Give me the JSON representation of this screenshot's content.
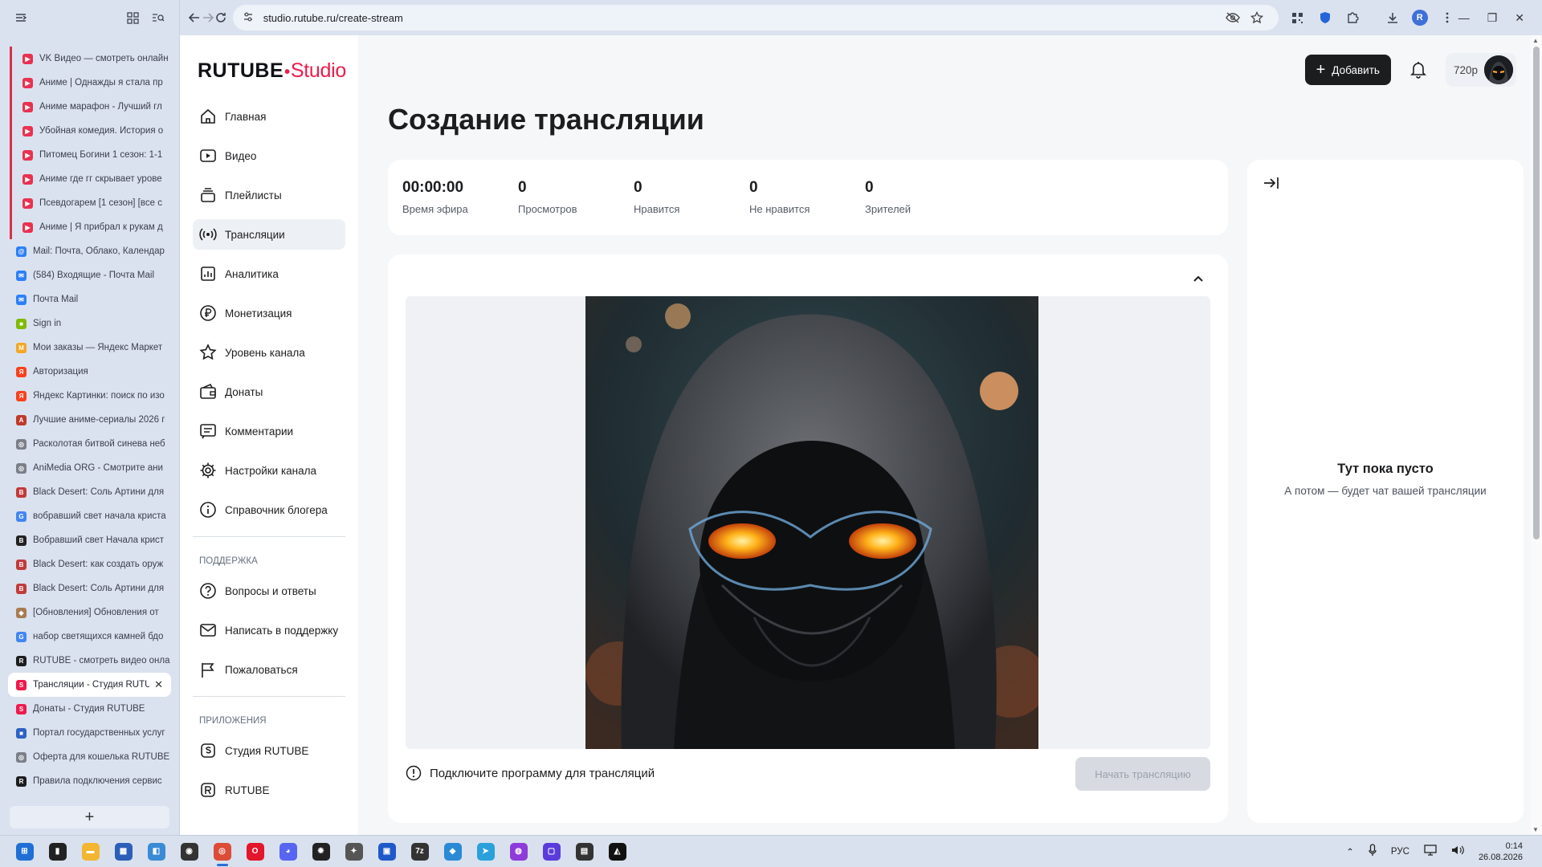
{
  "browser": {
    "url": "studio.rutube.ru/create-stream",
    "tabs": [
      {
        "title": "VK Видео — смотреть онлайн",
        "grouped": true,
        "color": "#e8324f",
        "glyph": "▶"
      },
      {
        "title": "Аниме | Однажды я стала пр",
        "grouped": true,
        "color": "#e8324f",
        "glyph": "▶"
      },
      {
        "title": "Аниме марафон - Лучший гл",
        "grouped": true,
        "color": "#e8324f",
        "glyph": "▶"
      },
      {
        "title": "Убойная комедия. История о",
        "grouped": true,
        "color": "#e8324f",
        "glyph": "▶"
      },
      {
        "title": "Питомец Богини 1 сезон: 1-1",
        "grouped": true,
        "color": "#e8324f",
        "glyph": "▶"
      },
      {
        "title": "Аниме где гг скрывает урове",
        "grouped": true,
        "color": "#e8324f",
        "glyph": "▶"
      },
      {
        "title": "Псевдогарем [1 сезон] [все с",
        "grouped": true,
        "color": "#e8324f",
        "glyph": "▶"
      },
      {
        "title": "Аниме | Я прибрал к рукам д",
        "grouped": true,
        "color": "#e8324f",
        "glyph": "▶"
      },
      {
        "title": "Mail: Почта, Облако, Календар",
        "grouped": false,
        "color": "#2d7ff9",
        "glyph": "@"
      },
      {
        "title": "(584) Входящие - Почта Mail",
        "grouped": false,
        "color": "#2d7ff9",
        "glyph": "✉"
      },
      {
        "title": "Почта Mail",
        "grouped": false,
        "color": "#2d7ff9",
        "glyph": "✉"
      },
      {
        "title": "Sign in",
        "grouped": false,
        "color": "#7fba00",
        "glyph": "■"
      },
      {
        "title": "Мои заказы — Яндекс Маркет",
        "grouped": false,
        "color": "#f5a623",
        "glyph": "М"
      },
      {
        "title": "Авторизация",
        "grouped": false,
        "color": "#fc3f1d",
        "glyph": "Я"
      },
      {
        "title": "Яндекс Картинки: поиск по изо",
        "grouped": false,
        "color": "#fc3f1d",
        "glyph": "Я"
      },
      {
        "title": "Лучшие аниме-сериалы 2026 г",
        "grouped": false,
        "color": "#c0392b",
        "glyph": "A"
      },
      {
        "title": "Расколотая битвой синева неб",
        "grouped": false,
        "color": "#7a7f8a",
        "glyph": "◎"
      },
      {
        "title": "AniMedia ORG - Смотрите ани",
        "grouped": false,
        "color": "#7a7f8a",
        "glyph": "◎"
      },
      {
        "title": "Black Desert: Соль Артини для",
        "grouped": false,
        "color": "#c23a3a",
        "glyph": "B"
      },
      {
        "title": "вобравший свет начала криста",
        "grouped": false,
        "color": "#4285f4",
        "glyph": "G"
      },
      {
        "title": "Вобравший свет Начала крист",
        "grouped": false,
        "color": "#222222",
        "glyph": "B"
      },
      {
        "title": "Black Desert: как создать оруж",
        "grouped": false,
        "color": "#c23a3a",
        "glyph": "B"
      },
      {
        "title": "Black Desert: Соль Артини для",
        "grouped": false,
        "color": "#c23a3a",
        "glyph": "B"
      },
      {
        "title": "[Обновления] Обновления от",
        "grouped": false,
        "color": "#a67c52",
        "glyph": "◆"
      },
      {
        "title": "набор светящихся камней бдо",
        "grouped": false,
        "color": "#4285f4",
        "glyph": "G"
      },
      {
        "title": "RUTUBE - смотреть видео онла",
        "grouped": false,
        "color": "#1c1d1f",
        "glyph": "R"
      },
      {
        "title": "Трансляции - Студия RUTUBE",
        "grouped": false,
        "active": true,
        "color": "#ee1a4b",
        "glyph": "S"
      },
      {
        "title": "Донаты - Студия RUTUBE",
        "grouped": false,
        "color": "#ee1a4b",
        "glyph": "S"
      },
      {
        "title": "Портал государственных услуг",
        "grouped": false,
        "color": "#2d62c4",
        "glyph": "■"
      },
      {
        "title": "Оферта для кошелька RUTUBE",
        "grouped": false,
        "color": "#7a7f8a",
        "glyph": "◎"
      },
      {
        "title": "Правила подключения сервис",
        "grouped": false,
        "color": "#1c1d1f",
        "glyph": "R"
      }
    ],
    "new_tab": "+"
  },
  "app": {
    "logo_main": "RUTUBE",
    "logo_sub": "Studio",
    "nav": [
      {
        "label": "Главная",
        "icon": "home-icon"
      },
      {
        "label": "Видео",
        "icon": "video-icon"
      },
      {
        "label": "Плейлисты",
        "icon": "playlist-icon"
      },
      {
        "label": "Трансляции",
        "icon": "broadcast-icon",
        "active": true
      },
      {
        "label": "Аналитика",
        "icon": "analytics-icon"
      },
      {
        "label": "Монетизация",
        "icon": "ruble-icon"
      },
      {
        "label": "Уровень канала",
        "icon": "star-icon"
      },
      {
        "label": "Донаты",
        "icon": "wallet-icon"
      },
      {
        "label": "Комментарии",
        "icon": "comment-icon"
      },
      {
        "label": "Настройки канала",
        "icon": "gear-icon"
      },
      {
        "label": "Справочник блогера",
        "icon": "info-icon"
      }
    ],
    "support_title": "ПОДДЕРЖКА",
    "support": [
      {
        "label": "Вопросы и ответы",
        "icon": "question-icon"
      },
      {
        "label": "Написать в поддержку",
        "icon": "mail-icon"
      },
      {
        "label": "Пожаловаться",
        "icon": "flag-icon"
      }
    ],
    "apps_title": "ПРИЛОЖЕНИЯ",
    "apps": [
      {
        "label": "Студия RUTUBE",
        "icon": "studio-icon"
      },
      {
        "label": "RUTUBE",
        "icon": "rutube-icon"
      }
    ],
    "header": {
      "add_label": "Добавить",
      "quality": "720p"
    }
  },
  "page": {
    "title": "Создание трансляции",
    "stats": [
      {
        "value": "00:00:00",
        "label": "Время эфира"
      },
      {
        "value": "0",
        "label": "Просмотров"
      },
      {
        "value": "0",
        "label": "Нравится"
      },
      {
        "value": "0",
        "label": "Не нравится"
      },
      {
        "value": "0",
        "label": "Зрителей"
      }
    ],
    "hint": "Подключите программу для трансляций",
    "start_button": "Начать трансляцию",
    "chat_empty_title": "Тут пока пусто",
    "chat_empty_sub": "А потом — будет чат вашей трансляции"
  },
  "taskbar": {
    "lang": "РУС",
    "time": "0:14",
    "date": "26.08.2026",
    "apps": [
      {
        "name": "windows-start",
        "color": "#1f6fd6",
        "glyph": "⊞"
      },
      {
        "name": "file-explorer",
        "color": "#222",
        "glyph": "▮"
      },
      {
        "name": "folder",
        "color": "#f2b632",
        "glyph": "▬"
      },
      {
        "name": "store",
        "color": "#2b5fb8",
        "glyph": "▦"
      },
      {
        "name": "photos",
        "color": "#3a8ad6",
        "glyph": "◧"
      },
      {
        "name": "game-app",
        "color": "#333",
        "glyph": "◉"
      },
      {
        "name": "chrome",
        "color": "#dd4b39",
        "glyph": "◎",
        "active": true
      },
      {
        "name": "opera",
        "color": "#e3162b",
        "glyph": "O"
      },
      {
        "name": "discord",
        "color": "#5865f2",
        "glyph": "◕"
      },
      {
        "name": "app-yellow",
        "color": "#222",
        "glyph": "✹"
      },
      {
        "name": "app-tool",
        "color": "#555",
        "glyph": "✦"
      },
      {
        "name": "app-blue",
        "color": "#1f58c8",
        "glyph": "▣"
      },
      {
        "name": "7zip",
        "color": "#333",
        "glyph": "7z"
      },
      {
        "name": "app-stack",
        "color": "#2a8ad6",
        "glyph": "◆"
      },
      {
        "name": "telegram",
        "color": "#2aa1da",
        "glyph": "➤"
      },
      {
        "name": "app-purple",
        "color": "#8e3bdb",
        "glyph": "◍"
      },
      {
        "name": "app-violet",
        "color": "#5b3bdb",
        "glyph": "▢"
      },
      {
        "name": "app-lock",
        "color": "#333",
        "glyph": "▤"
      },
      {
        "name": "app-ghost",
        "color": "#111",
        "glyph": "◭"
      }
    ]
  }
}
